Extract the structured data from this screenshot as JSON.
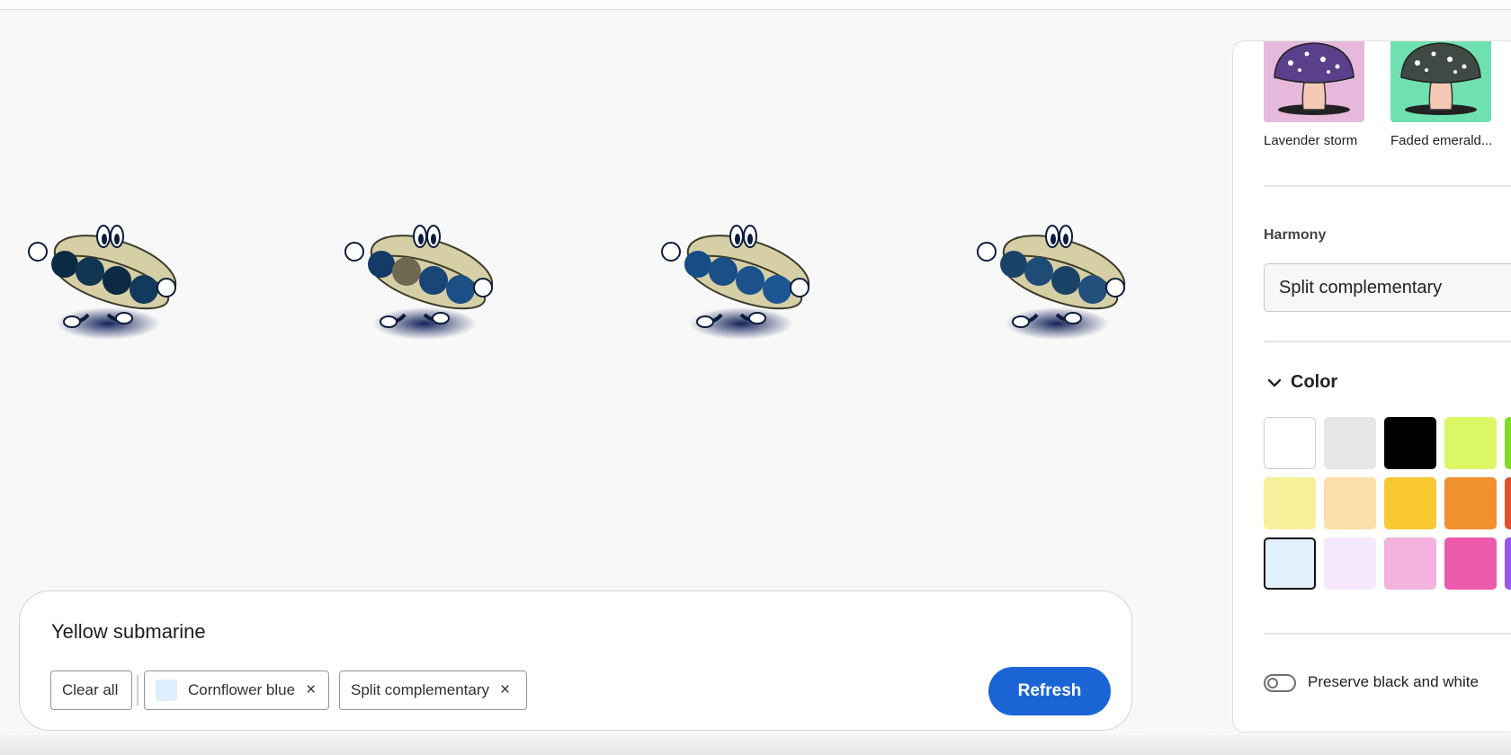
{
  "prompt": {
    "text": "Yellow submarine",
    "chips": {
      "clear_all": "Clear all",
      "color_chip": {
        "label": "Cornflower blue",
        "swatch": "#ddeefc"
      },
      "harmony_chip": {
        "label": "Split complementary"
      },
      "remove_glyph": "×"
    },
    "refresh_label": "Refresh"
  },
  "variations": [
    {
      "name": "variation-1",
      "fillings": [
        "#0d2a45",
        "#123551",
        "#0d2a45",
        "#123a5c"
      ],
      "bread": "#d6cfa6"
    },
    {
      "name": "variation-2",
      "fillings": [
        "#143a66",
        "#6e6a52",
        "#1a4577",
        "#1c4f85"
      ],
      "bread": "#d6cfa6"
    },
    {
      "name": "variation-3",
      "fillings": [
        "#174d86",
        "#1a4f88",
        "#1b528c",
        "#1d5692"
      ],
      "bread": "#d6cfa6"
    },
    {
      "name": "variation-4",
      "fillings": [
        "#1b4368",
        "#1f4c77",
        "#1b4368",
        "#21507d"
      ],
      "bread": "#d6cfa6"
    }
  ],
  "panel": {
    "presets": [
      {
        "label": "Lavender storm",
        "bg": "#e6b8dc",
        "cap": "#5a3f8a"
      },
      {
        "label": "Faded emerald...",
        "bg": "#6fe0b0",
        "cap": "#3f4a44"
      }
    ],
    "harmony": {
      "label": "Harmony",
      "value": "Split complementary"
    },
    "color": {
      "title": "Color",
      "swatches": [
        [
          "#ffffff",
          "#e6e6e6",
          "#000000",
          "#dcf766",
          "#7edc2a"
        ],
        [
          "#f8ef9a",
          "#fddfa9",
          "#f9c934",
          "#f0902f",
          "#e4502a"
        ],
        [
          "#e2f1fd",
          "#f5e8fc",
          "#f3b3df",
          "#ec5aae",
          "#9a55ec"
        ]
      ],
      "selected": "#e2f1fd"
    },
    "preserve_bw": {
      "label": "Preserve black and white",
      "on": false
    }
  }
}
